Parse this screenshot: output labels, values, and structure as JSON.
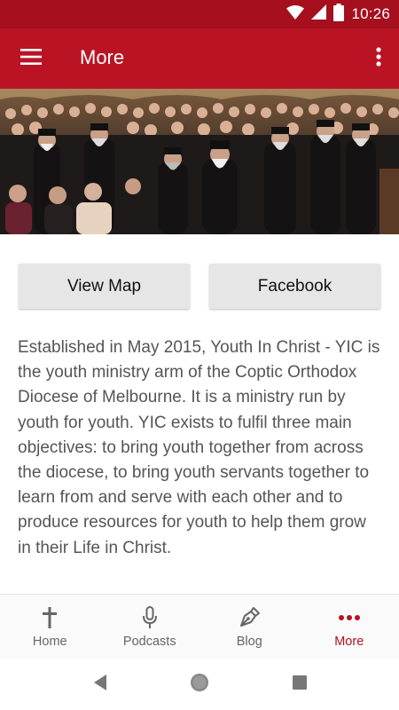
{
  "status_bar": {
    "time": "10:26",
    "icons": [
      "wifi-icon",
      "cell-signal-icon",
      "battery-icon"
    ]
  },
  "app_bar": {
    "title": "More",
    "menu_icon": "hamburger-menu-icon",
    "overflow_icon": "more-vertical-icon"
  },
  "hero": {
    "image": "group-photo-clergy-and-youth"
  },
  "buttons": {
    "view_map": "View Map",
    "facebook": "Facebook"
  },
  "description": "Established in May 2015, Youth In Christ - YIC is the youth ministry arm of the Coptic Orthodox Diocese of Melbourne. It is a ministry run by youth for youth. YIC exists to fulfil three main objectives: to bring youth together from across the diocese, to bring youth servants together to learn from and serve with each other and to produce resources for youth to help them grow in their Life in Christ.",
  "bottom_nav": {
    "items": [
      {
        "label": "Home",
        "icon": "cross-icon",
        "active": false
      },
      {
        "label": "Podcasts",
        "icon": "microphone-icon",
        "active": false
      },
      {
        "label": "Blog",
        "icon": "pen-nib-icon",
        "active": false
      },
      {
        "label": "More",
        "icon": "more-horizontal-icon",
        "active": true
      }
    ]
  },
  "system_nav": {
    "icons": [
      "back-triangle-icon",
      "home-circle-icon",
      "recents-square-icon"
    ]
  },
  "colors": {
    "app_bar": "#ba1424",
    "status_bar": "#a50f1e",
    "accent": "#b5121f",
    "button_bg": "#e6e6e6",
    "body_text": "#555555"
  }
}
